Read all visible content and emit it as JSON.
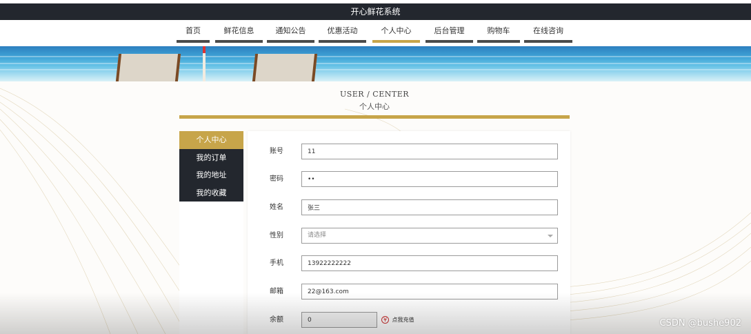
{
  "app": {
    "title": "开心鲜花系统"
  },
  "nav": {
    "items": [
      {
        "label": "首页"
      },
      {
        "label": "鲜花信息"
      },
      {
        "label": "通知公告"
      },
      {
        "label": "优惠活动"
      },
      {
        "label": "个人中心"
      },
      {
        "label": "后台管理"
      },
      {
        "label": "购物车"
      },
      {
        "label": "在线咨询"
      }
    ],
    "active": "个人中心"
  },
  "page": {
    "title_en": "USER / CENTER",
    "title_zh": "个人中心"
  },
  "sidebar": {
    "items": [
      {
        "label": "个人中心"
      },
      {
        "label": "我的订单"
      },
      {
        "label": "我的地址"
      },
      {
        "label": "我的收藏"
      }
    ]
  },
  "form": {
    "account": {
      "label": "账号",
      "value": "11"
    },
    "password": {
      "label": "密码",
      "value": "••"
    },
    "name": {
      "label": "姓名",
      "value": "张三"
    },
    "gender": {
      "label": "性别",
      "placeholder": "请选择"
    },
    "phone": {
      "label": "手机",
      "value": "13922222222"
    },
    "email": {
      "label": "邮箱",
      "value": "22@163.com"
    },
    "balance": {
      "label": "余额",
      "value": "0",
      "recharge_label": "点我充值"
    }
  },
  "watermark": "CSDN @bushe902",
  "colors": {
    "accent": "#c7a54a",
    "dark": "#23272e"
  }
}
